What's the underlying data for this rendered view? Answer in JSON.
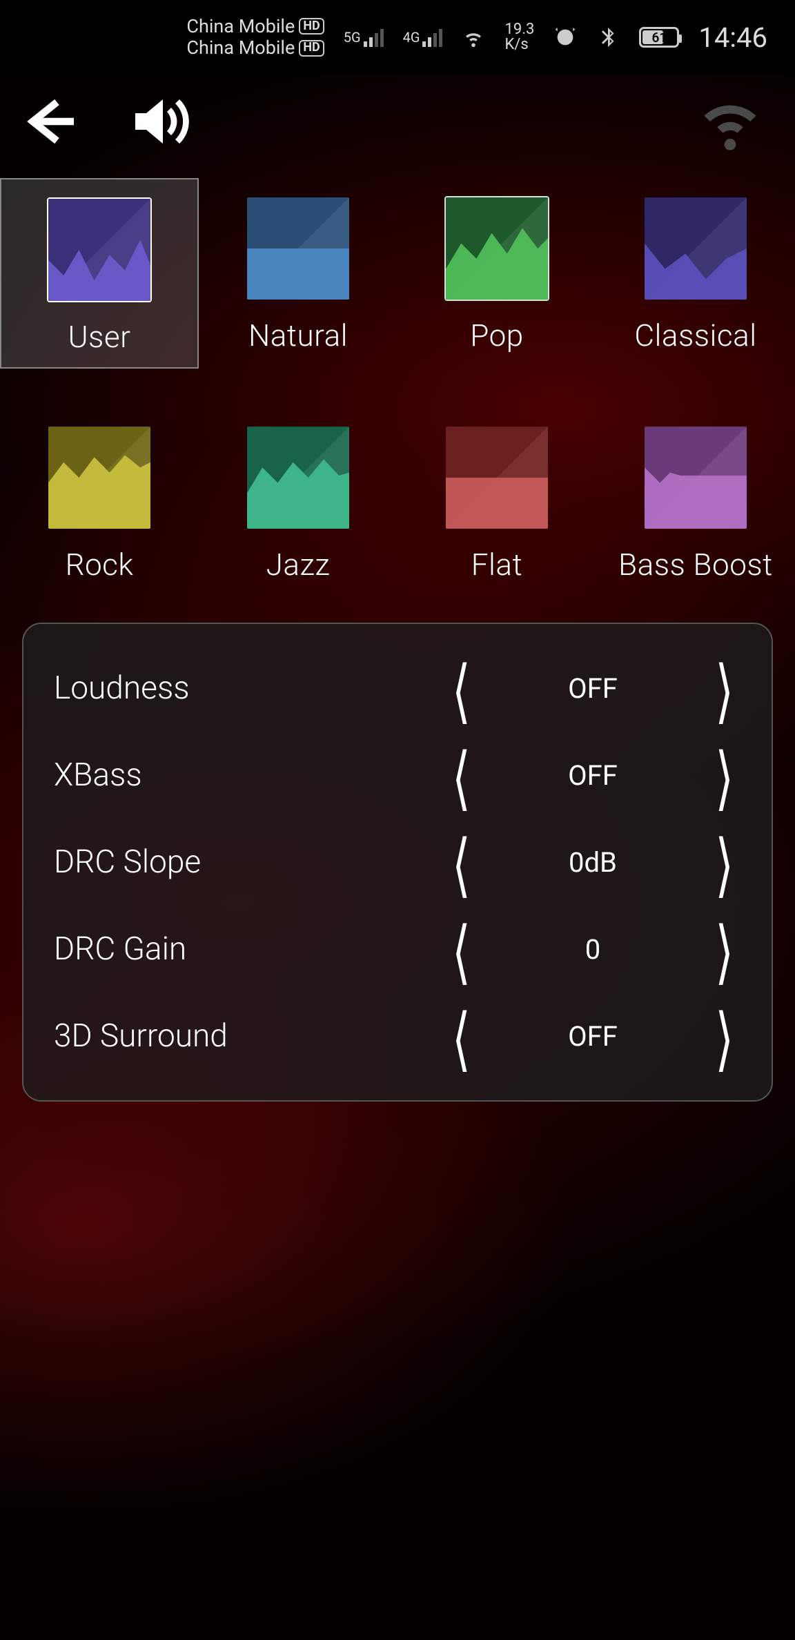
{
  "status": {
    "carrier1": "China Mobile",
    "carrier2": "China Mobile",
    "net1": "5G",
    "net2": "4G",
    "speed_num": "19.3",
    "speed_unit": "K/s",
    "battery_pct": "61",
    "time": "14:46"
  },
  "presets": [
    {
      "label": "User",
      "selected": true,
      "color": "purple"
    },
    {
      "label": "Natural",
      "selected": false,
      "color": "blue"
    },
    {
      "label": "Pop",
      "selected": false,
      "color": "green"
    },
    {
      "label": "Classical",
      "selected": false,
      "color": "indigo"
    },
    {
      "label": "Rock",
      "selected": false,
      "color": "yellow"
    },
    {
      "label": "Jazz",
      "selected": false,
      "color": "teal"
    },
    {
      "label": "Flat",
      "selected": false,
      "color": "red"
    },
    {
      "label": "Bass Boost",
      "selected": false,
      "color": "pink"
    }
  ],
  "settings": [
    {
      "label": "Loudness",
      "value": "OFF"
    },
    {
      "label": "XBass",
      "value": "OFF"
    },
    {
      "label": "DRC Slope",
      "value": "0dB"
    },
    {
      "label": "DRC Gain",
      "value": "0"
    },
    {
      "label": "3D Surround",
      "value": "OFF"
    }
  ],
  "glyph": {
    "left": "❬",
    "right": "❭"
  }
}
